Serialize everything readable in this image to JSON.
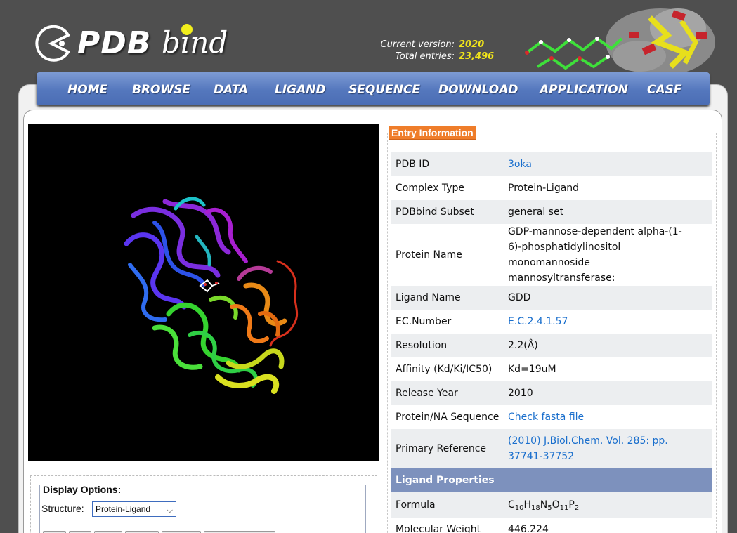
{
  "header": {
    "logo_text_main": "PDB",
    "logo_text_secondary": "bind",
    "version_label": "Current version:",
    "version_value": "2020",
    "entries_label": "Total entries:",
    "entries_value": "23,496"
  },
  "nav": {
    "items": [
      "HOME",
      "BROWSE",
      "DATA",
      "LIGAND",
      "SEQUENCE",
      "DOWNLOAD",
      "APPLICATION",
      "CASF"
    ]
  },
  "display_options": {
    "legend": "Display Options:",
    "structure_label": "Structure:",
    "structure_selected": "Protein-Ligand"
  },
  "entry": {
    "legend": "Entry Information",
    "rows": [
      {
        "key": "PDB ID",
        "value": "3oka"
      },
      {
        "key": "Complex Type",
        "value": "Protein-Ligand"
      },
      {
        "key": "PDBbind Subset",
        "value": "general set"
      },
      {
        "key": "Protein Name",
        "value": "GDP-mannose-dependent alpha-(1-6)-phosphatidylinositol monomannoside mannosyltransferase:"
      },
      {
        "key": "Ligand Name",
        "value": "GDD"
      },
      {
        "key": "EC.Number",
        "value": "E.C.2.4.1.57"
      },
      {
        "key": "Resolution",
        "value": "2.2(Å)"
      },
      {
        "key": "Affinity (Kd/Ki/IC50)",
        "value": "Kd=19uM"
      },
      {
        "key": "Release Year",
        "value": "2010"
      },
      {
        "key": "Protein/NA Sequence",
        "value": "Check fasta file"
      },
      {
        "key": "Primary Reference",
        "value": "(2010) J.Biol.Chem. Vol. 285: pp. 37741-37752"
      }
    ],
    "ligand_section": "Ligand Properties",
    "formula_key": "Formula",
    "formula_parts": [
      "C",
      "10",
      "H",
      "18",
      "N",
      "5",
      "O",
      "11",
      "P",
      "2"
    ],
    "mw_key": "Molecular Weight",
    "mw_value": "446.224"
  },
  "colors": {
    "accent_orange": "#ef7d2a",
    "nav_blue": "#5477bd",
    "link_blue": "#1a6fcd",
    "section_blue": "#7d91bd"
  }
}
